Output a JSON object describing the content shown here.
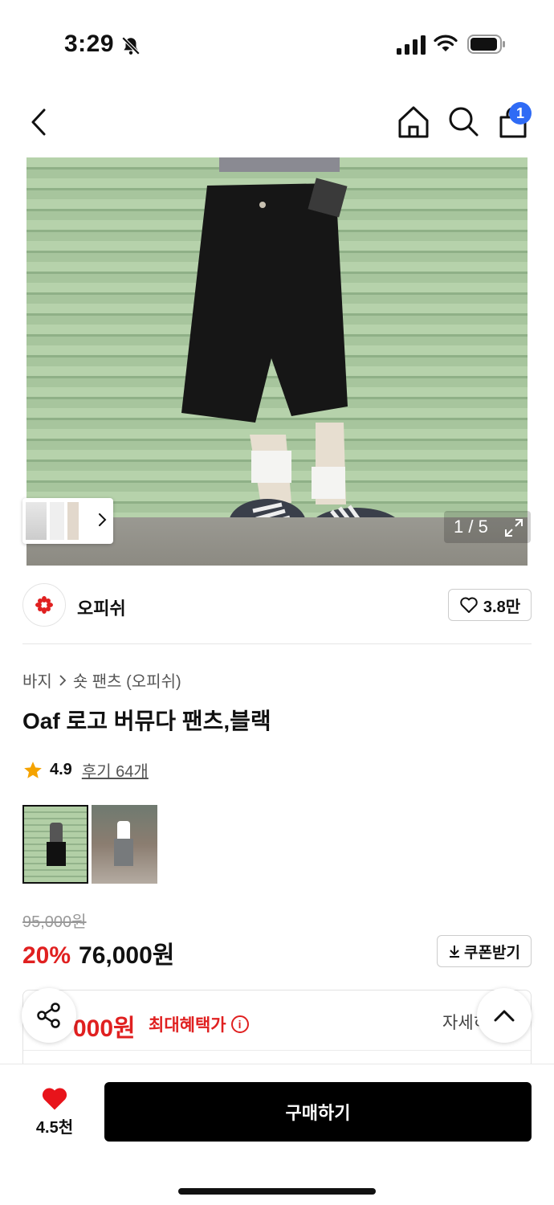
{
  "status_bar": {
    "time": "3:29",
    "icons": [
      "bell-slash-icon",
      "signal-icon",
      "wifi-icon",
      "battery-icon"
    ]
  },
  "header": {
    "icons": [
      "chevron-left-icon",
      "home-icon",
      "search-icon",
      "shopping-bag-icon"
    ],
    "cart_count": "1"
  },
  "gallery": {
    "page_indicator": "1 / 5",
    "expand_icon": "expand-icon"
  },
  "brand": {
    "name": "오피쉬",
    "likes": "3.8만",
    "logo_color": "#e02020"
  },
  "breadcrumb": {
    "category": "바지",
    "subcategory": "숏 팬츠 (오피쉬)"
  },
  "product": {
    "title": "Oaf 로고 버뮤다 팬츠,블랙",
    "rating": "4.9",
    "reviews": "후기 64개",
    "original_price": "95,000원",
    "discount": "20%",
    "price": "76,000원",
    "coupon_label": "쿠폰받기"
  },
  "benefit": {
    "price": "000원",
    "label": "최대혜택가",
    "detail": "자세히"
  },
  "bottom_bar": {
    "wish_count": "4.5천",
    "buy_label": "구매하기"
  },
  "colors": {
    "accent_red": "#e02020",
    "badge_blue": "#2f6bf5",
    "primary_black": "#000000"
  }
}
